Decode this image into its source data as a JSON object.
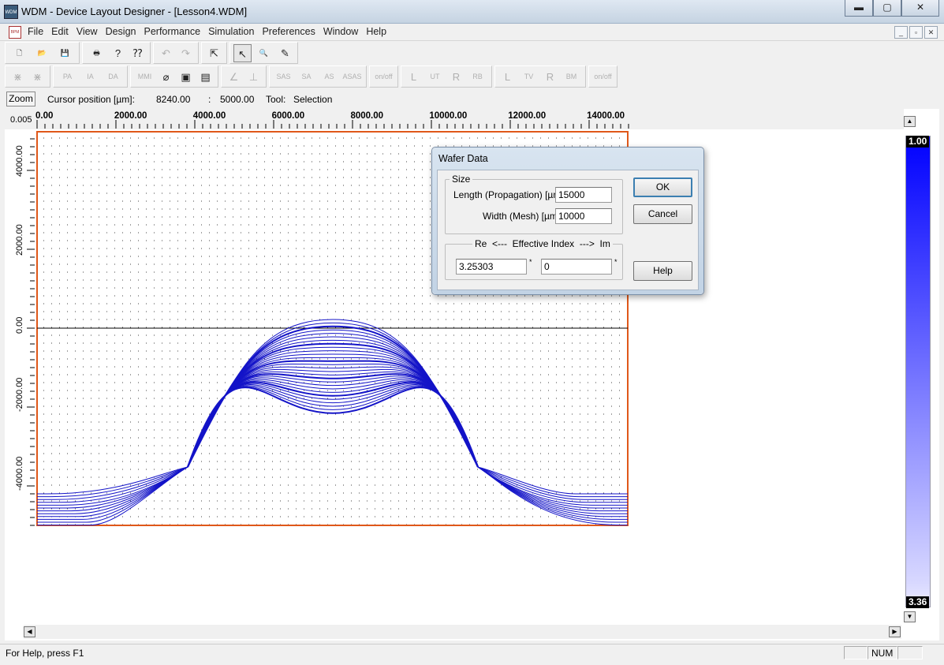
{
  "window": {
    "title": "WDM - Device Layout Designer - [Lesson4.WDM]",
    "app_icon_text": "WDM",
    "controls": {
      "minimize": "▬",
      "maximize": "▢",
      "close": "✕"
    }
  },
  "menu": {
    "doc_icon_text": "BPM",
    "items": [
      "File",
      "Edit",
      "View",
      "Design",
      "Performance",
      "Simulation",
      "Preferences",
      "Window",
      "Help"
    ],
    "mdi_controls": [
      "_",
      "▫",
      "✕"
    ]
  },
  "toolbar1": {
    "groups": [
      [
        {
          "icon": "new-file-icon",
          "glyph": "🗋"
        },
        {
          "icon": "open-folder-icon",
          "glyph": "📂"
        },
        {
          "icon": "save-icon",
          "glyph": "💾"
        }
      ],
      [
        {
          "icon": "print-icon",
          "glyph": "🖶"
        },
        {
          "icon": "about-icon",
          "glyph": "?"
        },
        {
          "icon": "context-help-icon",
          "glyph": "⁇"
        }
      ],
      [
        {
          "icon": "undo-icon",
          "glyph": "↶",
          "disabled": true
        },
        {
          "icon": "redo-icon",
          "glyph": "↷",
          "disabled": true
        }
      ],
      [
        {
          "icon": "snap-cursor-icon",
          "glyph": "⇱"
        }
      ],
      [
        {
          "icon": "select-arrow-icon",
          "glyph": "↖",
          "pressed": true
        },
        {
          "icon": "zoom-icon",
          "glyph": "🔍"
        },
        {
          "icon": "wizard-icon",
          "glyph": "✎"
        }
      ]
    ]
  },
  "toolbar2": {
    "groups": [
      [
        {
          "icon": "taper-linear-icon",
          "glyph": "⋇",
          "disabled": true
        },
        {
          "icon": "taper-exp-icon",
          "glyph": "⋇",
          "disabled": true
        }
      ],
      [
        {
          "icon": "pa-waveguide-icon",
          "glyph": "PA",
          "disabled": true
        },
        {
          "icon": "ia-waveguide-icon",
          "glyph": "IA",
          "disabled": true
        },
        {
          "icon": "da-waveguide-icon",
          "glyph": "DA",
          "disabled": true
        }
      ],
      [
        {
          "icon": "mmi-icon",
          "glyph": "MMI",
          "disabled": true
        },
        {
          "icon": "fiber-icon",
          "glyph": "⌀"
        },
        {
          "icon": "input-field-icon",
          "glyph": "▣"
        },
        {
          "icon": "monitor-icon",
          "glyph": "▤"
        }
      ],
      [
        {
          "icon": "angle-icon",
          "glyph": "∠",
          "disabled": true
        },
        {
          "icon": "ruler-icon",
          "glyph": "⊥",
          "disabled": true
        }
      ],
      [
        {
          "icon": "sas-icon",
          "glyph": "SAS",
          "disabled": true
        },
        {
          "icon": "sa-icon",
          "glyph": "SA",
          "disabled": true
        },
        {
          "icon": "as-icon",
          "glyph": "AS",
          "disabled": true
        },
        {
          "icon": "asas-icon",
          "glyph": "ASAS",
          "disabled": true
        }
      ],
      [
        {
          "icon": "on-off-icon",
          "glyph": "on/off",
          "disabled": true
        }
      ],
      [
        {
          "icon": "l-bend-icon",
          "glyph": "L",
          "disabled": true
        },
        {
          "icon": "ut-bend-icon",
          "glyph": "UT",
          "disabled": true
        },
        {
          "icon": "r-bend-icon",
          "glyph": "R",
          "disabled": true
        },
        {
          "icon": "rb-bend-icon",
          "glyph": "RB",
          "disabled": true
        }
      ],
      [
        {
          "icon": "l-port-icon",
          "glyph": "L",
          "disabled": true
        },
        {
          "icon": "tv-port-icon",
          "glyph": "TV",
          "disabled": true
        },
        {
          "icon": "r-port-icon",
          "glyph": "R",
          "disabled": true
        },
        {
          "icon": "bm-port-icon",
          "glyph": "BM",
          "disabled": true
        }
      ],
      [
        {
          "icon": "on-off-2-icon",
          "glyph": "on/off",
          "disabled": true
        }
      ]
    ]
  },
  "infobar": {
    "zoom_label": "Zoom",
    "cursor_label": "Cursor position [µm]:",
    "cursor_x": "8240.00",
    "separator": ":",
    "cursor_y": "5000.00",
    "tool_label": "Tool:",
    "tool_value": "Selection"
  },
  "ruler": {
    "corner_value": "0.005",
    "x_ticks": [
      "0.00",
      "2000.00",
      "4000.00",
      "6000.00",
      "8000.00",
      "10000.00",
      "12000.00",
      "14000.00"
    ],
    "y_ticks": [
      "4000.00",
      "2000.00",
      "0.00",
      "-2000.00",
      "-4000.00"
    ]
  },
  "layout_view": {
    "wafer_length_um": 15000,
    "wafer_width_um": 10000,
    "border_color": "#e0581a",
    "waveguide_color": "#1414c8",
    "grid_dot_color": "#404040"
  },
  "colorbar": {
    "top_value": "1.00",
    "bottom_value": "3.36",
    "top_color": "#0000ff",
    "bottom_color": "#ecebff"
  },
  "dialog": {
    "title": "Wafer Data",
    "size_group": "Size",
    "length_label": "Length (Propagation) [µm]:",
    "length_value": "15000",
    "width_label": "Width (Mesh) [µm]:",
    "width_value": "10000",
    "index_group": "Re  <---  Effective Index  --->  Im",
    "re_value": "3.25303",
    "im_value": "0",
    "star": "*",
    "ok": "OK",
    "cancel": "Cancel",
    "help": "Help"
  },
  "statusbar": {
    "help_text": "For Help, press F1",
    "num_indicator": "NUM"
  }
}
